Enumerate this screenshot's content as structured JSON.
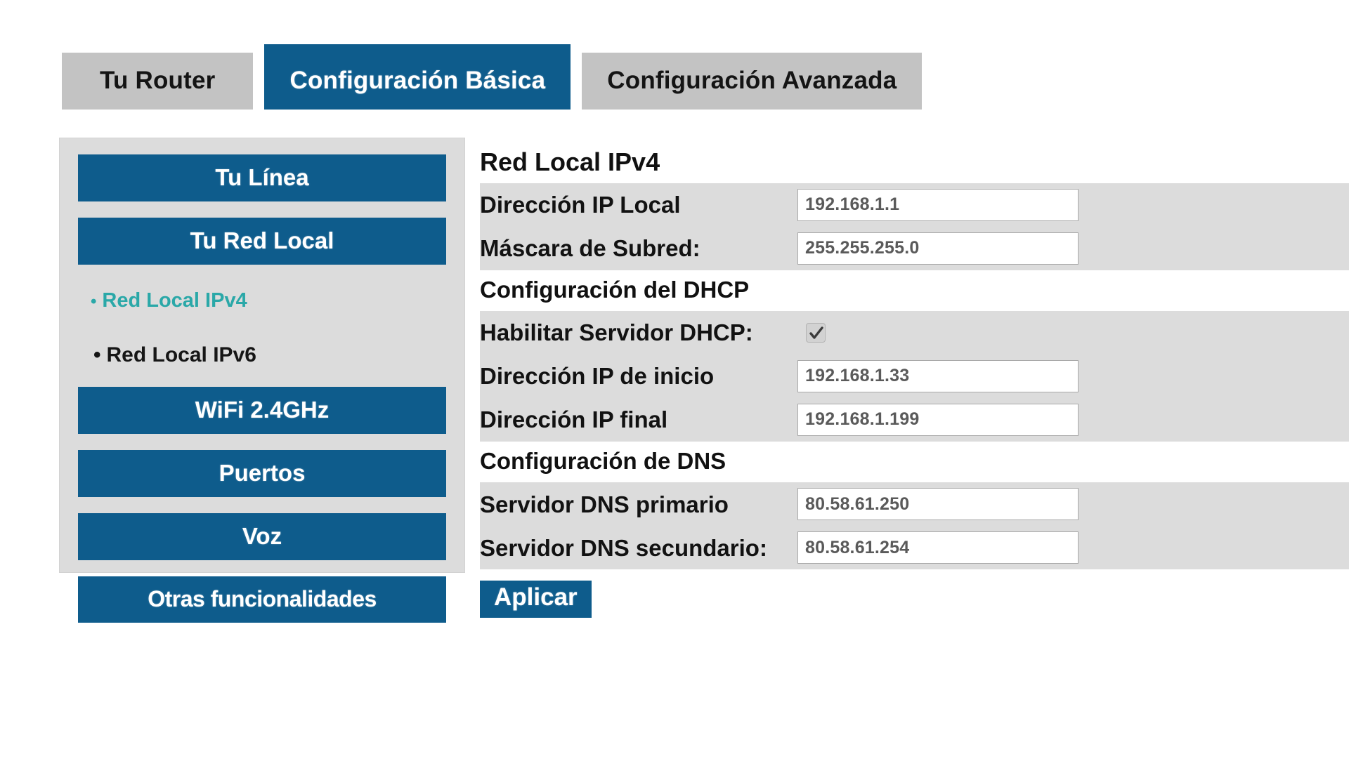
{
  "tabs": [
    {
      "label": "Tu Router",
      "active": false
    },
    {
      "label": "Configuración Básica",
      "active": true
    },
    {
      "label": "Configuración Avanzada",
      "active": false
    }
  ],
  "sidebar": {
    "items": [
      {
        "label": "Tu Línea",
        "type": "button"
      },
      {
        "label": "Tu Red Local",
        "type": "button"
      },
      {
        "label": "Red Local IPv4",
        "type": "subitem",
        "active": true
      },
      {
        "label": "Red Local IPv6",
        "type": "subitem",
        "active": false
      },
      {
        "label": "WiFi 2.4GHz",
        "type": "button"
      },
      {
        "label": "Puertos",
        "type": "button"
      },
      {
        "label": "Voz",
        "type": "button"
      },
      {
        "label": "Otras funcionalidades",
        "type": "button"
      }
    ],
    "bullet_glyph": "•"
  },
  "main": {
    "heading": "Red Local IPv4",
    "ipv4": {
      "rows": [
        {
          "label": "Dirección IP Local",
          "value": "192.168.1.1"
        },
        {
          "label": "Máscara de Subred:",
          "value": "255.255.255.0"
        }
      ]
    },
    "dhcp": {
      "heading": "Configuración del DHCP",
      "enable_label": "Habilitar Servidor DHCP:",
      "enable_checked": true,
      "rows": [
        {
          "label": "Dirección IP de inicio",
          "value": "192.168.1.33"
        },
        {
          "label": "Dirección IP final",
          "value": "192.168.1.199"
        }
      ]
    },
    "dns": {
      "heading": "Configuración de DNS",
      "rows": [
        {
          "label": "Servidor DNS primario",
          "value": "80.58.61.250"
        },
        {
          "label": "Servidor DNS secundario:",
          "value": "80.58.61.254"
        }
      ]
    },
    "apply_label": "Aplicar"
  },
  "colors": {
    "accent_blue": "#0e5c8c",
    "tab_inactive": "#c3c3c3",
    "panel_grey": "#dcdcdc",
    "active_subitem_teal": "#2aa8a8",
    "field_text": "#5a5a5a"
  }
}
